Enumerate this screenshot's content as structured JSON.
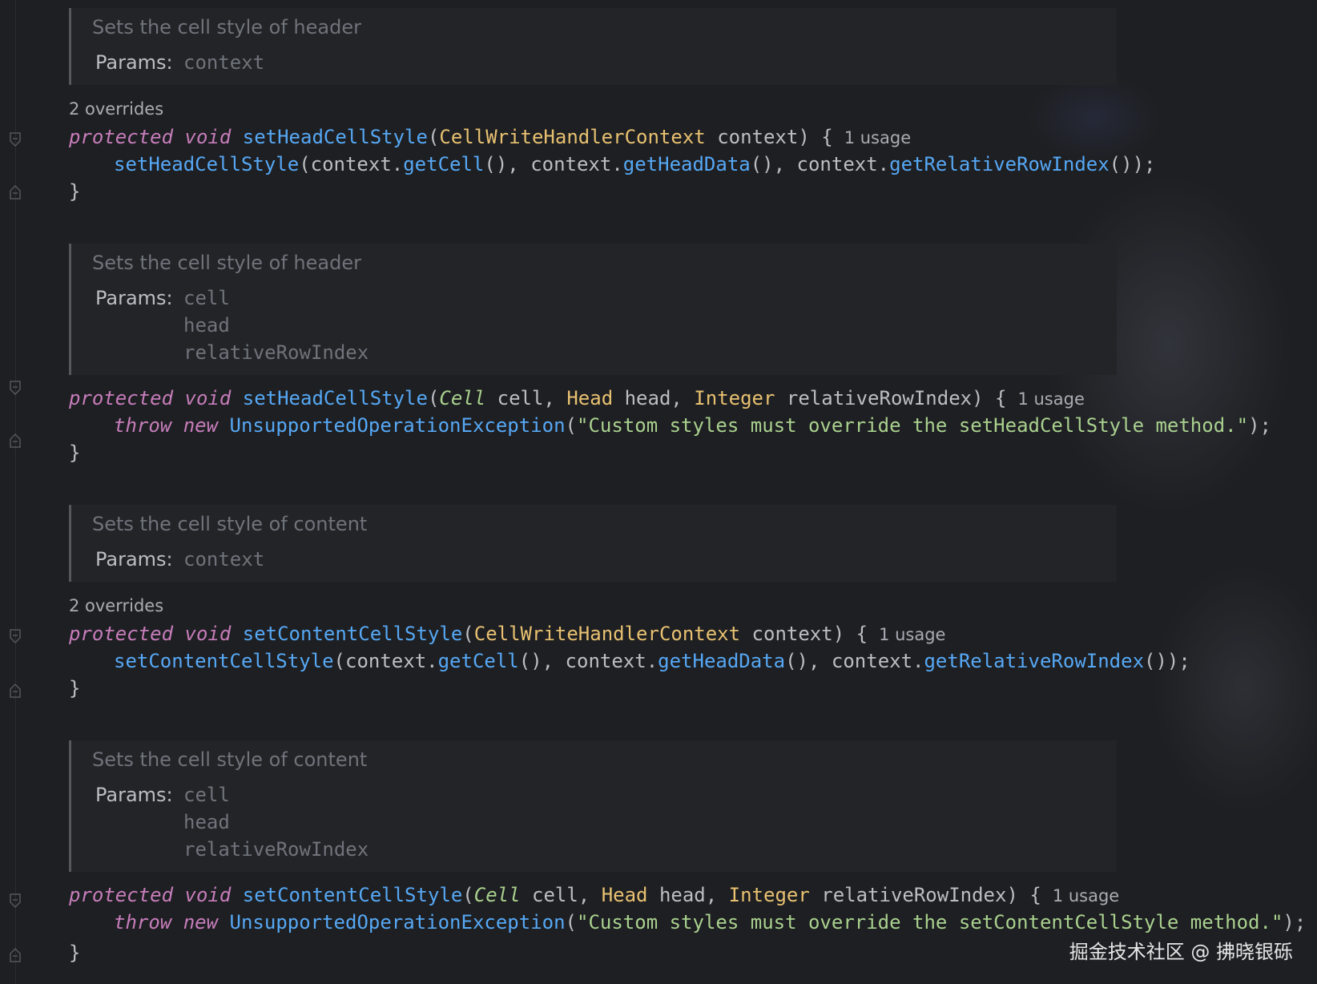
{
  "blocks": [
    {
      "doc": {
        "summary": "Sets the cell style of header",
        "params_label": "Params:",
        "params": [
          "context"
        ]
      },
      "overrides": "2 overrides",
      "signature": {
        "modifier": "protected",
        "ret": "void",
        "name": "setHeadCellStyle",
        "open": "(",
        "args": [
          {
            "type": "CellWriteHandlerContext",
            "name": "context"
          }
        ],
        "close": ") {",
        "usage": "1 usage"
      },
      "body": {
        "call": "setHeadCellStyle",
        "text1": "(context.",
        "m1": "getCell",
        "text2": "(), context.",
        "m2": "getHeadData",
        "text3": "(), context.",
        "m3": "getRelativeRowIndex",
        "text4": "());"
      },
      "end": "}"
    },
    {
      "doc": {
        "summary": "Sets the cell style of header",
        "params_label": "Params:",
        "params": [
          "cell",
          "head",
          "relativeRowIndex"
        ]
      },
      "signature": {
        "modifier": "protected",
        "ret": "void",
        "name": "setHeadCellStyle",
        "open": "(",
        "arg1_type": "Cell",
        "arg1_name": " cell, ",
        "arg2_type": "Head",
        "arg2_name": " head, ",
        "arg3_type": "Integer",
        "arg3_name": " relativeRowIndex",
        "close": ") {",
        "usage": "1 usage"
      },
      "body": {
        "throw": "throw",
        "new": "new",
        "exc": "UnsupportedOperationException",
        "open": "(",
        "msg": "\"Custom styles must override the setHeadCellStyle method.\"",
        "close": ");"
      },
      "end": "}"
    },
    {
      "doc": {
        "summary": "Sets the cell style of content",
        "params_label": "Params:",
        "params": [
          "context"
        ]
      },
      "overrides": "2 overrides",
      "signature": {
        "modifier": "protected",
        "ret": "void",
        "name": "setContentCellStyle",
        "open": "(",
        "args": [
          {
            "type": "CellWriteHandlerContext",
            "name": "context"
          }
        ],
        "close": ") {",
        "usage": "1 usage"
      },
      "body": {
        "call": "setContentCellStyle",
        "text1": "(context.",
        "m1": "getCell",
        "text2": "(), context.",
        "m2": "getHeadData",
        "text3": "(), context.",
        "m3": "getRelativeRowIndex",
        "text4": "());"
      },
      "end": "}"
    },
    {
      "doc": {
        "summary": "Sets the cell style of content",
        "params_label": "Params:",
        "params": [
          "cell",
          "head",
          "relativeRowIndex"
        ]
      },
      "signature": {
        "modifier": "protected",
        "ret": "void",
        "name": "setContentCellStyle",
        "open": "(",
        "arg1_type": "Cell",
        "arg1_name": " cell, ",
        "arg2_type": "Head",
        "arg2_name": " head, ",
        "arg3_type": "Integer",
        "arg3_name": " relativeRowIndex",
        "close": ") {",
        "usage": "1 usage"
      },
      "body": {
        "throw": "throw",
        "new": "new",
        "exc": "UnsupportedOperationException",
        "open": "(",
        "msg": "\"Custom styles must override the setContentCellStyle method.\"",
        "close": ");"
      },
      "end": "}"
    }
  ],
  "watermark": "掘金技术社区 @ 拂晓银砾",
  "colors": {
    "background": "#1e1f22",
    "keyword": "#c77dbb",
    "function": "#56a8f5",
    "type": "#e8c171",
    "string": "#a9d18e",
    "text": "#bcbec4"
  }
}
